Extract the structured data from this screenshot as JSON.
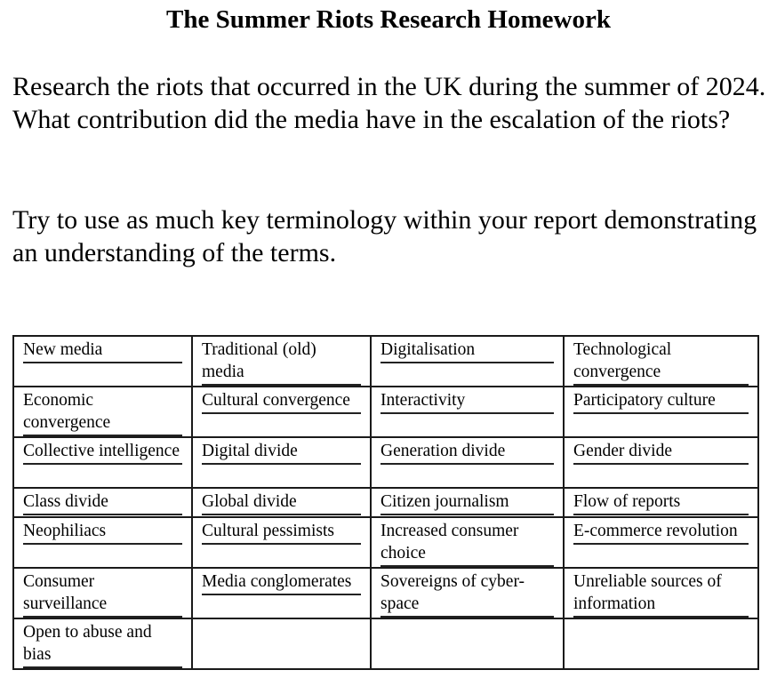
{
  "document": {
    "title": "The Summer Riots Research Homework",
    "paragraphs": [
      "Research the riots that occurred in the UK during the summer of 2024. What contribution did the media have in the escalation of the riots?",
      "Try to use as much key terminology within your report demonstrating an understanding of the terms."
    ],
    "terms_table": {
      "rows": [
        [
          "New media",
          "Traditional (old) media",
          "Digitalisation",
          "Technological convergence"
        ],
        [
          "Economic convergence",
          "Cultural convergence",
          "Interactivity",
          "Participatory culture"
        ],
        [
          "Collective intelligence",
          "Digital divide",
          "Generation divide",
          "Gender divide"
        ],
        [
          "Class divide",
          "Global divide",
          "Citizen journalism",
          "Flow of reports"
        ],
        [
          "Neophiliacs",
          "Cultural pessimists",
          "Increased consumer choice",
          "E-commerce revolution"
        ],
        [
          "Consumer surveillance",
          "Media conglomerates",
          "Sovereigns of cyber-space",
          "Unreliable sources of information"
        ],
        [
          "Open to abuse and bias",
          "",
          "",
          ""
        ]
      ]
    }
  }
}
